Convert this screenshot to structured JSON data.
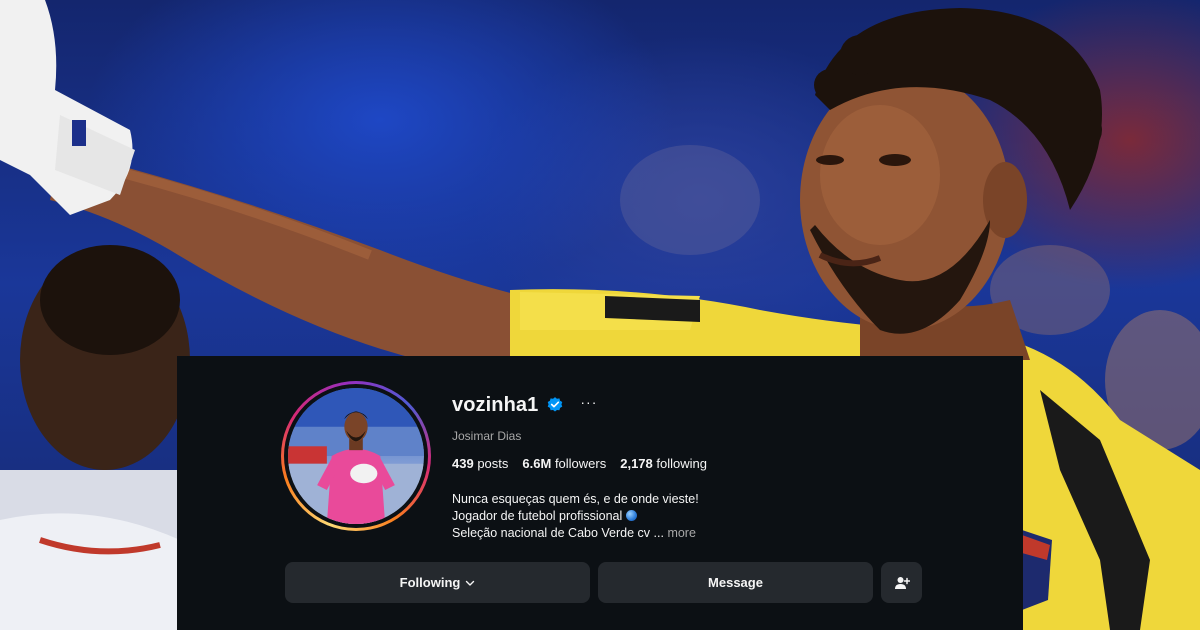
{
  "profile": {
    "username": "vozinha1",
    "full_name": "Josimar Dias",
    "verified": true,
    "more_icon": "more-horizontal-icon",
    "stats": {
      "posts_count": "439",
      "posts_label": "posts",
      "followers_count": "6.6M",
      "followers_label": "followers",
      "following_count": "2,178",
      "following_label": "following"
    },
    "bio": {
      "line1": "Nunca esqueças quem és, e de onde vieste!",
      "line2": "Jogador de futebol profissional",
      "line3": "Seleção nacional de Cabo Verde cv ...",
      "more_label": "more"
    }
  },
  "actions": {
    "following_label": "Following",
    "message_label": "Message",
    "add_user_icon": "add-user-icon"
  },
  "colors": {
    "panel_bg": "#0c1014",
    "button_bg": "#25292e",
    "verified_blue": "#0095f6",
    "secondary_text": "#a8a8a8"
  }
}
